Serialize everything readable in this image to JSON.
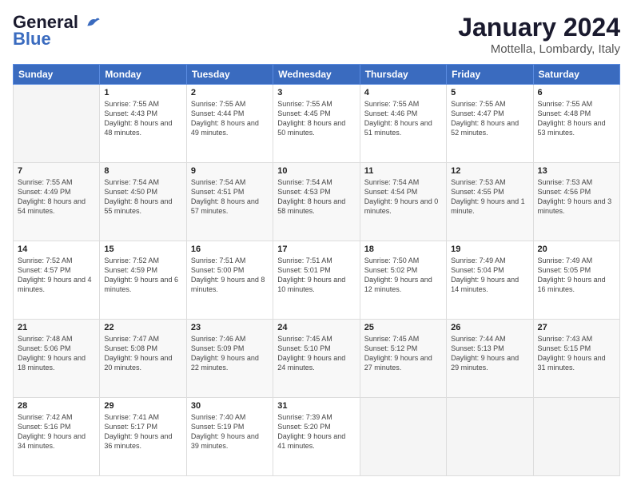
{
  "header": {
    "logo_line1": "General",
    "logo_line2": "Blue",
    "month_year": "January 2024",
    "location": "Mottella, Lombardy, Italy"
  },
  "days_of_week": [
    "Sunday",
    "Monday",
    "Tuesday",
    "Wednesday",
    "Thursday",
    "Friday",
    "Saturday"
  ],
  "weeks": [
    [
      {
        "day": "",
        "sunrise": "",
        "sunset": "",
        "daylight": ""
      },
      {
        "day": "1",
        "sunrise": "Sunrise: 7:55 AM",
        "sunset": "Sunset: 4:43 PM",
        "daylight": "Daylight: 8 hours and 48 minutes."
      },
      {
        "day": "2",
        "sunrise": "Sunrise: 7:55 AM",
        "sunset": "Sunset: 4:44 PM",
        "daylight": "Daylight: 8 hours and 49 minutes."
      },
      {
        "day": "3",
        "sunrise": "Sunrise: 7:55 AM",
        "sunset": "Sunset: 4:45 PM",
        "daylight": "Daylight: 8 hours and 50 minutes."
      },
      {
        "day": "4",
        "sunrise": "Sunrise: 7:55 AM",
        "sunset": "Sunset: 4:46 PM",
        "daylight": "Daylight: 8 hours and 51 minutes."
      },
      {
        "day": "5",
        "sunrise": "Sunrise: 7:55 AM",
        "sunset": "Sunset: 4:47 PM",
        "daylight": "Daylight: 8 hours and 52 minutes."
      },
      {
        "day": "6",
        "sunrise": "Sunrise: 7:55 AM",
        "sunset": "Sunset: 4:48 PM",
        "daylight": "Daylight: 8 hours and 53 minutes."
      }
    ],
    [
      {
        "day": "7",
        "sunrise": "Sunrise: 7:55 AM",
        "sunset": "Sunset: 4:49 PM",
        "daylight": "Daylight: 8 hours and 54 minutes."
      },
      {
        "day": "8",
        "sunrise": "Sunrise: 7:54 AM",
        "sunset": "Sunset: 4:50 PM",
        "daylight": "Daylight: 8 hours and 55 minutes."
      },
      {
        "day": "9",
        "sunrise": "Sunrise: 7:54 AM",
        "sunset": "Sunset: 4:51 PM",
        "daylight": "Daylight: 8 hours and 57 minutes."
      },
      {
        "day": "10",
        "sunrise": "Sunrise: 7:54 AM",
        "sunset": "Sunset: 4:53 PM",
        "daylight": "Daylight: 8 hours and 58 minutes."
      },
      {
        "day": "11",
        "sunrise": "Sunrise: 7:54 AM",
        "sunset": "Sunset: 4:54 PM",
        "daylight": "Daylight: 9 hours and 0 minutes."
      },
      {
        "day": "12",
        "sunrise": "Sunrise: 7:53 AM",
        "sunset": "Sunset: 4:55 PM",
        "daylight": "Daylight: 9 hours and 1 minute."
      },
      {
        "day": "13",
        "sunrise": "Sunrise: 7:53 AM",
        "sunset": "Sunset: 4:56 PM",
        "daylight": "Daylight: 9 hours and 3 minutes."
      }
    ],
    [
      {
        "day": "14",
        "sunrise": "Sunrise: 7:52 AM",
        "sunset": "Sunset: 4:57 PM",
        "daylight": "Daylight: 9 hours and 4 minutes."
      },
      {
        "day": "15",
        "sunrise": "Sunrise: 7:52 AM",
        "sunset": "Sunset: 4:59 PM",
        "daylight": "Daylight: 9 hours and 6 minutes."
      },
      {
        "day": "16",
        "sunrise": "Sunrise: 7:51 AM",
        "sunset": "Sunset: 5:00 PM",
        "daylight": "Daylight: 9 hours and 8 minutes."
      },
      {
        "day": "17",
        "sunrise": "Sunrise: 7:51 AM",
        "sunset": "Sunset: 5:01 PM",
        "daylight": "Daylight: 9 hours and 10 minutes."
      },
      {
        "day": "18",
        "sunrise": "Sunrise: 7:50 AM",
        "sunset": "Sunset: 5:02 PM",
        "daylight": "Daylight: 9 hours and 12 minutes."
      },
      {
        "day": "19",
        "sunrise": "Sunrise: 7:49 AM",
        "sunset": "Sunset: 5:04 PM",
        "daylight": "Daylight: 9 hours and 14 minutes."
      },
      {
        "day": "20",
        "sunrise": "Sunrise: 7:49 AM",
        "sunset": "Sunset: 5:05 PM",
        "daylight": "Daylight: 9 hours and 16 minutes."
      }
    ],
    [
      {
        "day": "21",
        "sunrise": "Sunrise: 7:48 AM",
        "sunset": "Sunset: 5:06 PM",
        "daylight": "Daylight: 9 hours and 18 minutes."
      },
      {
        "day": "22",
        "sunrise": "Sunrise: 7:47 AM",
        "sunset": "Sunset: 5:08 PM",
        "daylight": "Daylight: 9 hours and 20 minutes."
      },
      {
        "day": "23",
        "sunrise": "Sunrise: 7:46 AM",
        "sunset": "Sunset: 5:09 PM",
        "daylight": "Daylight: 9 hours and 22 minutes."
      },
      {
        "day": "24",
        "sunrise": "Sunrise: 7:45 AM",
        "sunset": "Sunset: 5:10 PM",
        "daylight": "Daylight: 9 hours and 24 minutes."
      },
      {
        "day": "25",
        "sunrise": "Sunrise: 7:45 AM",
        "sunset": "Sunset: 5:12 PM",
        "daylight": "Daylight: 9 hours and 27 minutes."
      },
      {
        "day": "26",
        "sunrise": "Sunrise: 7:44 AM",
        "sunset": "Sunset: 5:13 PM",
        "daylight": "Daylight: 9 hours and 29 minutes."
      },
      {
        "day": "27",
        "sunrise": "Sunrise: 7:43 AM",
        "sunset": "Sunset: 5:15 PM",
        "daylight": "Daylight: 9 hours and 31 minutes."
      }
    ],
    [
      {
        "day": "28",
        "sunrise": "Sunrise: 7:42 AM",
        "sunset": "Sunset: 5:16 PM",
        "daylight": "Daylight: 9 hours and 34 minutes."
      },
      {
        "day": "29",
        "sunrise": "Sunrise: 7:41 AM",
        "sunset": "Sunset: 5:17 PM",
        "daylight": "Daylight: 9 hours and 36 minutes."
      },
      {
        "day": "30",
        "sunrise": "Sunrise: 7:40 AM",
        "sunset": "Sunset: 5:19 PM",
        "daylight": "Daylight: 9 hours and 39 minutes."
      },
      {
        "day": "31",
        "sunrise": "Sunrise: 7:39 AM",
        "sunset": "Sunset: 5:20 PM",
        "daylight": "Daylight: 9 hours and 41 minutes."
      },
      {
        "day": "",
        "sunrise": "",
        "sunset": "",
        "daylight": ""
      },
      {
        "day": "",
        "sunrise": "",
        "sunset": "",
        "daylight": ""
      },
      {
        "day": "",
        "sunrise": "",
        "sunset": "",
        "daylight": ""
      }
    ]
  ]
}
